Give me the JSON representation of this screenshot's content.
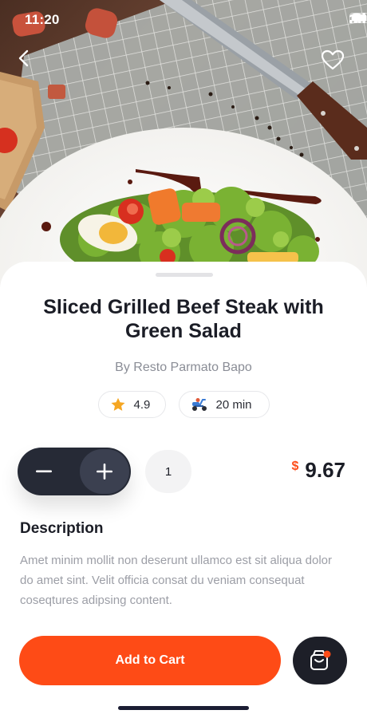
{
  "status_bar": {
    "time": "11:20"
  },
  "product": {
    "title": "Sliced Grilled Beef Steak with Green Salad",
    "restaurant": "By Resto Parmato Bapo",
    "rating": "4.9",
    "delivery_time": "20 min",
    "quantity": "1",
    "price_currency": "$",
    "price": "9.67"
  },
  "description": {
    "heading": "Description",
    "body": "Amet minim mollit non deserunt ullamco est sit aliqua dolor do amet sint. Velit officia consat du veniam consequat coseqtures adipsing content."
  },
  "actions": {
    "add_to_cart": "Add to Cart"
  },
  "colors": {
    "accent": "#fe4b16",
    "dark": "#1d1f28",
    "stepper": "#262a36",
    "star": "#f5a623"
  },
  "icons": [
    "back-icon",
    "heart-icon",
    "star-icon",
    "scooter-icon",
    "minus-icon",
    "plus-icon",
    "shopping-bag-icon"
  ]
}
